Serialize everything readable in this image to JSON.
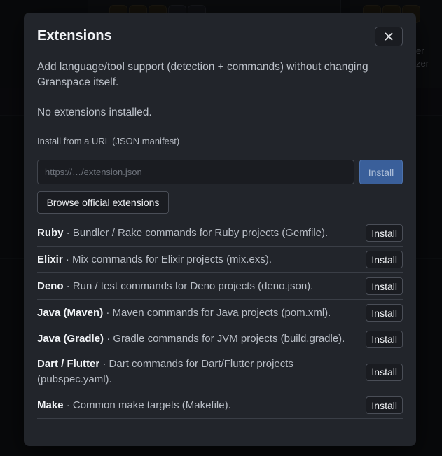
{
  "background": {
    "partial_text_1": "er",
    "partial_text_2": "zer"
  },
  "modal": {
    "title": "Extensions",
    "close_icon": "close-icon",
    "intro": "Add language/tool support (detection + commands) without changing Granspace itself.",
    "no_extensions": "No extensions installed.",
    "url_label": "Install from a URL (JSON manifest)",
    "url_placeholder": "https://…/extension.json",
    "url_value": "",
    "install_url_label": "Install",
    "browse_label": "Browse official extensions",
    "extensions": [
      {
        "name": "Ruby",
        "description": " · Bundler / Rake commands for Ruby projects (Gemfile).",
        "action": "Install"
      },
      {
        "name": "Elixir",
        "description": " · Mix commands for Elixir projects (mix.exs).",
        "action": "Install"
      },
      {
        "name": "Deno",
        "description": " · Run / test commands for Deno projects (deno.json).",
        "action": "Install"
      },
      {
        "name": "Java (Maven)",
        "description": " · Maven commands for Java projects (pom.xml).",
        "action": "Install"
      },
      {
        "name": "Java (Gradle)",
        "description": " · Gradle commands for JVM projects (build.gradle).",
        "action": "Install"
      },
      {
        "name": "Dart / Flutter",
        "description": " · Dart commands for Dart/Flutter projects (pubspec.yaml).",
        "action": "Install"
      },
      {
        "name": "Make",
        "description": " · Common make targets (Makefile).",
        "action": "Install"
      }
    ]
  },
  "colors": {
    "modal_bg": "#22252b",
    "primary_button": "#3a5f9a",
    "text_muted": "#bcc1c9"
  }
}
